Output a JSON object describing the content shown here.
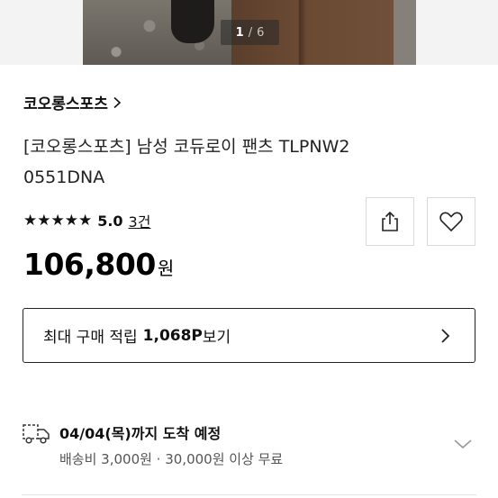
{
  "gallery": {
    "current_page": "1",
    "separator": "/",
    "total_pages": "6"
  },
  "product": {
    "brand": "코오롱스포츠",
    "title": "[코오롱스포츠] 남성 코듀로이 팬츠 TLPNW2 0551DNA",
    "stars": "★★★★★",
    "rating": "5.0",
    "review_count": "3건",
    "price": "106,800",
    "price_unit": "원"
  },
  "points": {
    "label": "최대 구매 적립",
    "amount": "1,068P",
    "more": "보기"
  },
  "delivery": {
    "arrival": "04/04(목)까지 도착 예정",
    "fee": "배송비 3,000원 · 30,000원 이상 무료"
  },
  "icons": {
    "brand_chevron": "chevron-right-icon",
    "share": "share-icon",
    "wish": "heart-icon",
    "point_arrow": "chevron-right-icon",
    "truck": "truck-icon",
    "expand": "chevron-down-icon"
  }
}
